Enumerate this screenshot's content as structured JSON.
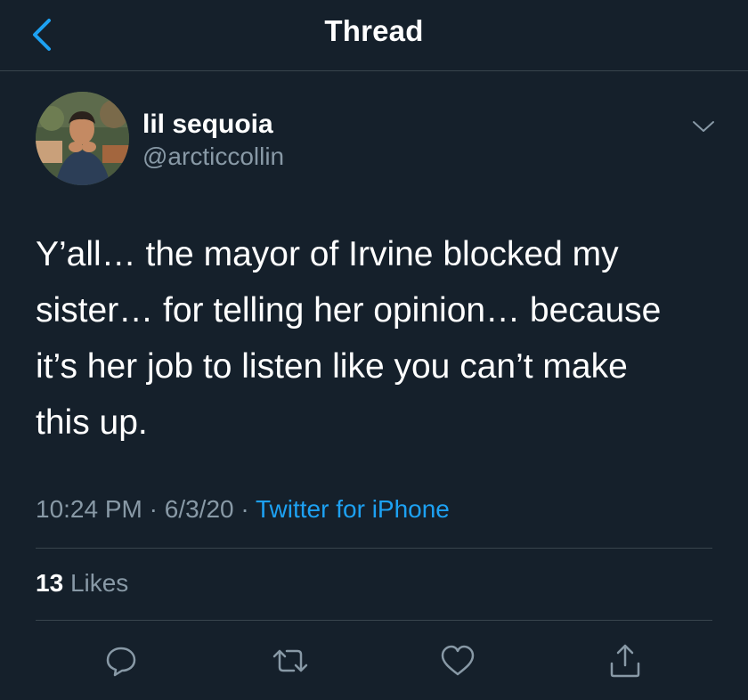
{
  "header": {
    "title": "Thread",
    "back_icon": "chevron-left-icon"
  },
  "author": {
    "display_name": "lil sequoia",
    "handle": "@arcticcollin",
    "menu_icon": "chevron-down-icon"
  },
  "tweet": {
    "text": "Y’all… the mayor of Irvine blocked my\nsister… for telling her opinion… because\nit’s her job to listen like you can’t make\nthis up.",
    "time": "10:24 PM",
    "date": "6/3/20",
    "separator": "·",
    "source": "Twitter for iPhone"
  },
  "stats": {
    "likes_count": "13",
    "likes_label": "Likes"
  },
  "actions": {
    "reply_icon": "reply-icon",
    "retweet_icon": "retweet-icon",
    "like_icon": "heart-icon",
    "share_icon": "share-icon"
  },
  "colors": {
    "background": "#15202b",
    "divider": "#38444d",
    "secondary_text": "#8899a6",
    "accent": "#1da1f2"
  }
}
